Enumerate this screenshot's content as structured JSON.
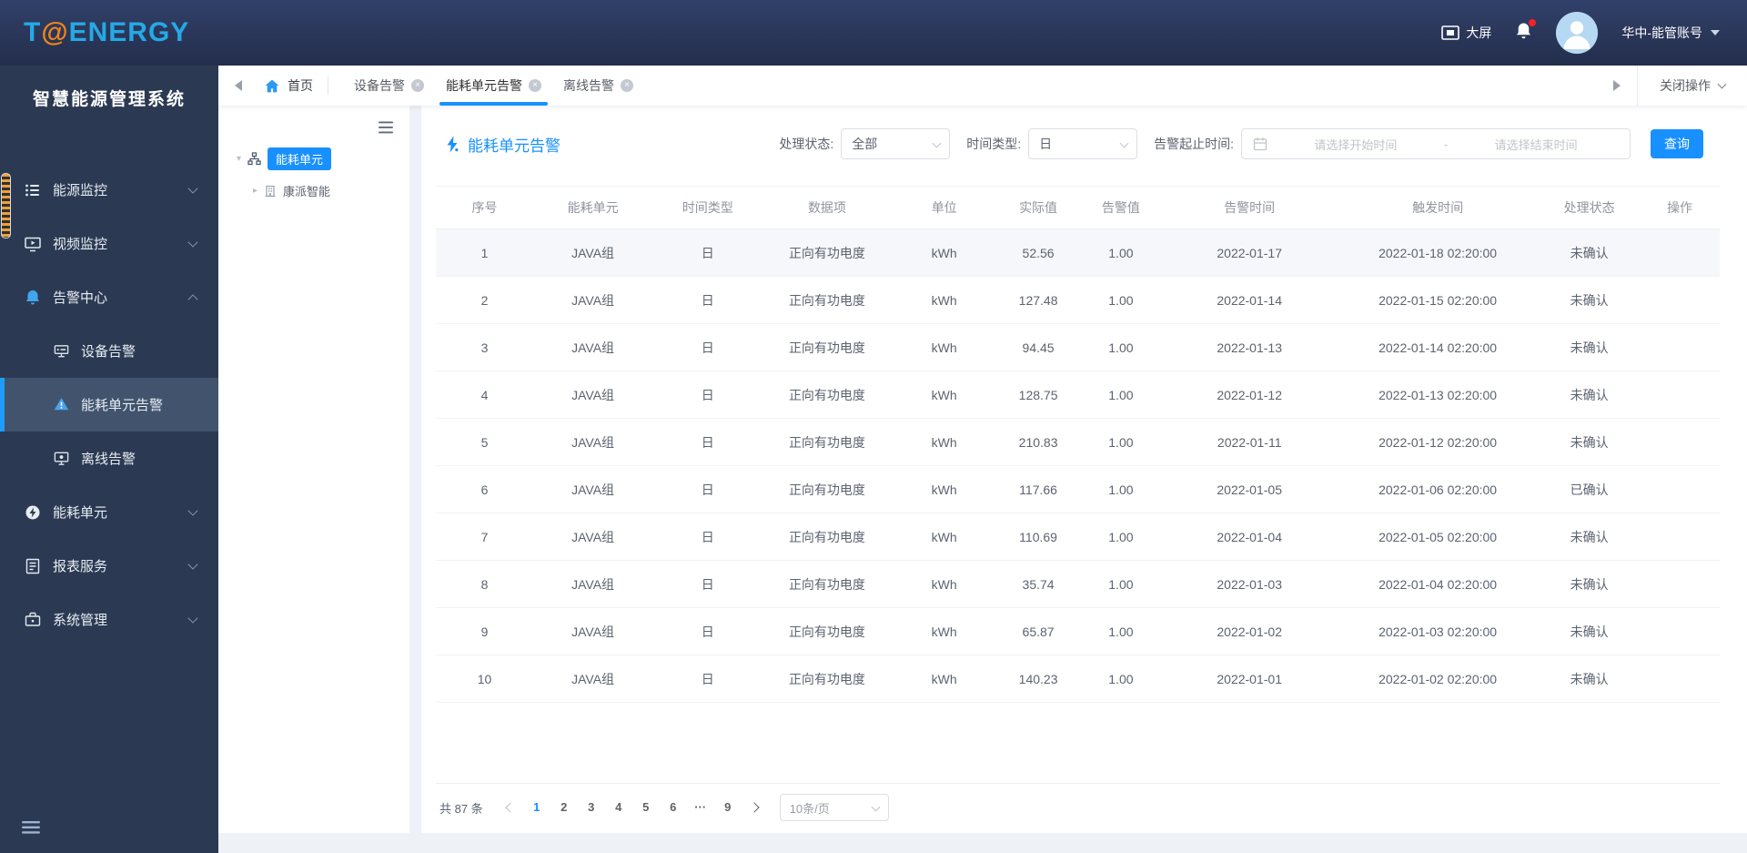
{
  "colors": {
    "accent": "#1890ff",
    "topbar_navy": "#2a3658",
    "sidebar_navy": "#2b3a52",
    "logo_blue": "#25a9e5",
    "logo_orange": "#f08519",
    "alert_red": "#f5222d"
  },
  "topbar": {
    "logo_t": "T",
    "logo_at": "@",
    "logo_rest": "ENERGY",
    "big_screen": "大屏",
    "account": "华中-能管账号"
  },
  "sidebar": {
    "system_title": "智慧能源管理系统",
    "items": [
      {
        "label": "能源监控"
      },
      {
        "label": "视频监控"
      },
      {
        "label": "告警中心",
        "children": [
          {
            "label": "设备告警"
          },
          {
            "label": "能耗单元告警",
            "active": true
          },
          {
            "label": "离线告警"
          }
        ]
      },
      {
        "label": "能耗单元"
      },
      {
        "label": "报表服务"
      },
      {
        "label": "系统管理"
      }
    ]
  },
  "tabs": {
    "home": "首页",
    "items": [
      "设备告警",
      "能耗单元告警",
      "离线告警"
    ],
    "active_tab": "能耗单元告警",
    "close_action": "关闭操作"
  },
  "tree": {
    "root": "能耗单元",
    "child": "康派智能"
  },
  "filters": {
    "title": "能耗单元告警",
    "status_label": "处理状态:",
    "status_value": "全部",
    "time_type_label": "时间类型:",
    "time_type_value": "日",
    "range_label": "告警起止时间:",
    "start_placeholder": "请选择开始时间",
    "range_separator": "-",
    "end_placeholder": "请选择结束时间",
    "search_label": "查询"
  },
  "table": {
    "headers": [
      "序号",
      "能耗单元",
      "时间类型",
      "数据项",
      "单位",
      "实际值",
      "告警值",
      "告警时间",
      "触发时间",
      "处理状态",
      "操作"
    ],
    "rows": [
      {
        "seq": "1",
        "unit": "JAVA组",
        "time_type": "日",
        "item": "正向有功电度",
        "measure": "kWh",
        "actual": "52.56",
        "threshold": "1.00",
        "alarm_time": "2022-01-17",
        "trigger_time": "2022-01-18 02:20:00",
        "status": "未确认",
        "highlight": true
      },
      {
        "seq": "2",
        "unit": "JAVA组",
        "time_type": "日",
        "item": "正向有功电度",
        "measure": "kWh",
        "actual": "127.48",
        "threshold": "1.00",
        "alarm_time": "2022-01-14",
        "trigger_time": "2022-01-15 02:20:00",
        "status": "未确认"
      },
      {
        "seq": "3",
        "unit": "JAVA组",
        "time_type": "日",
        "item": "正向有功电度",
        "measure": "kWh",
        "actual": "94.45",
        "threshold": "1.00",
        "alarm_time": "2022-01-13",
        "trigger_time": "2022-01-14 02:20:00",
        "status": "未确认"
      },
      {
        "seq": "4",
        "unit": "JAVA组",
        "time_type": "日",
        "item": "正向有功电度",
        "measure": "kWh",
        "actual": "128.75",
        "threshold": "1.00",
        "alarm_time": "2022-01-12",
        "trigger_time": "2022-01-13 02:20:00",
        "status": "未确认"
      },
      {
        "seq": "5",
        "unit": "JAVA组",
        "time_type": "日",
        "item": "正向有功电度",
        "measure": "kWh",
        "actual": "210.83",
        "threshold": "1.00",
        "alarm_time": "2022-01-11",
        "trigger_time": "2022-01-12 02:20:00",
        "status": "未确认"
      },
      {
        "seq": "6",
        "unit": "JAVA组",
        "time_type": "日",
        "item": "正向有功电度",
        "measure": "kWh",
        "actual": "117.66",
        "threshold": "1.00",
        "alarm_time": "2022-01-05",
        "trigger_time": "2022-01-06 02:20:00",
        "status": "已确认"
      },
      {
        "seq": "7",
        "unit": "JAVA组",
        "time_type": "日",
        "item": "正向有功电度",
        "measure": "kWh",
        "actual": "110.69",
        "threshold": "1.00",
        "alarm_time": "2022-01-04",
        "trigger_time": "2022-01-05 02:20:00",
        "status": "未确认"
      },
      {
        "seq": "8",
        "unit": "JAVA组",
        "time_type": "日",
        "item": "正向有功电度",
        "measure": "kWh",
        "actual": "35.74",
        "threshold": "1.00",
        "alarm_time": "2022-01-03",
        "trigger_time": "2022-01-04 02:20:00",
        "status": "未确认"
      },
      {
        "seq": "9",
        "unit": "JAVA组",
        "time_type": "日",
        "item": "正向有功电度",
        "measure": "kWh",
        "actual": "65.87",
        "threshold": "1.00",
        "alarm_time": "2022-01-02",
        "trigger_time": "2022-01-03 02:20:00",
        "status": "未确认"
      },
      {
        "seq": "10",
        "unit": "JAVA组",
        "time_type": "日",
        "item": "正向有功电度",
        "measure": "kWh",
        "actual": "140.23",
        "threshold": "1.00",
        "alarm_time": "2022-01-01",
        "trigger_time": "2022-01-02 02:20:00",
        "status": "未确认"
      }
    ]
  },
  "pagination": {
    "total": "共 87 条",
    "pages": [
      {
        "label": "1",
        "active": true
      },
      {
        "label": "2"
      },
      {
        "label": "3"
      },
      {
        "label": "4"
      },
      {
        "label": "5"
      },
      {
        "label": "6"
      },
      {
        "label": "···"
      },
      {
        "label": "9"
      }
    ],
    "page_size": "10条/页"
  }
}
